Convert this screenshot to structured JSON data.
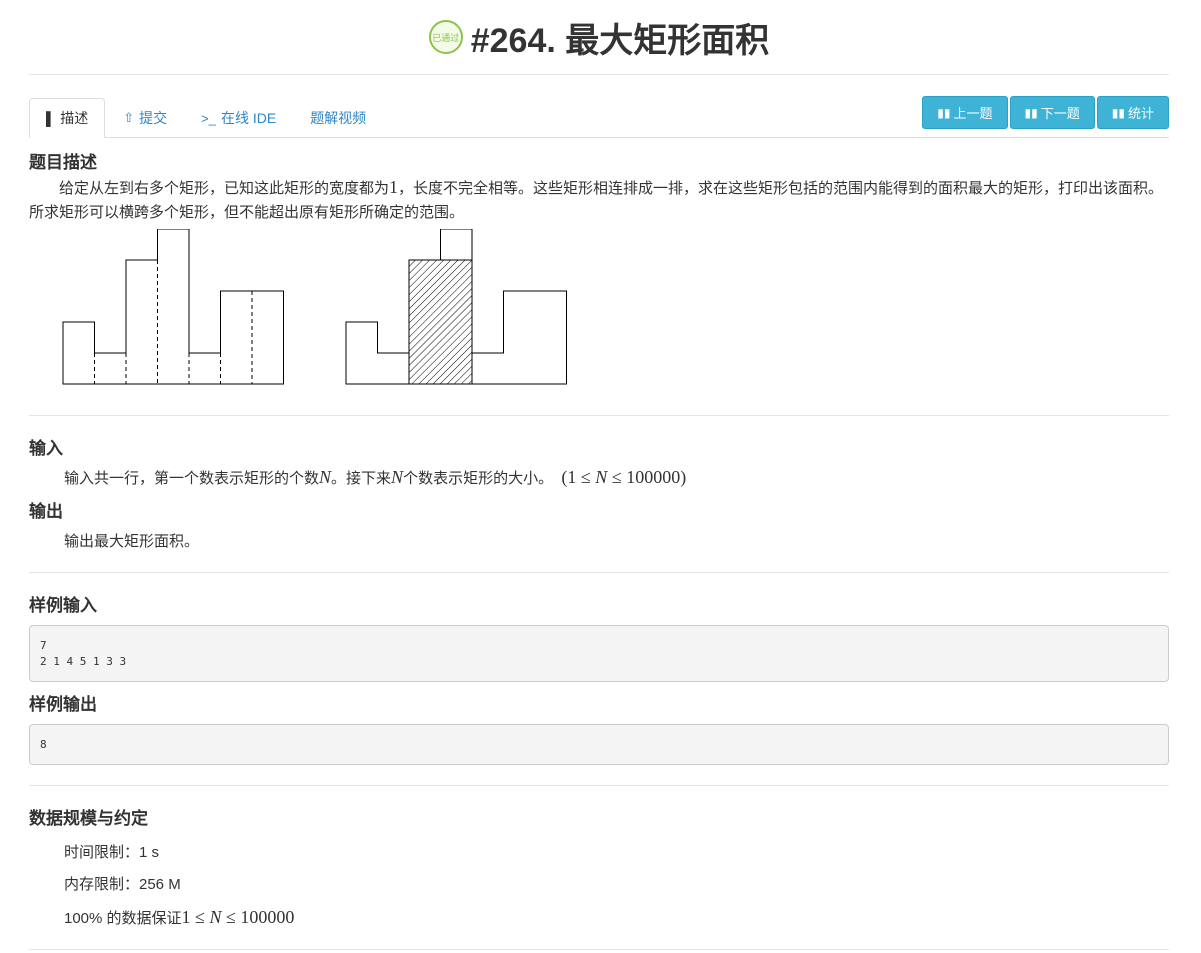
{
  "header": {
    "badge_text": "已通过",
    "title": "#264. 最大矩形面积"
  },
  "tabs": [
    {
      "icon": "book-icon",
      "glyph": "▌",
      "label": "描述"
    },
    {
      "icon": "upload-icon",
      "glyph": "⇧",
      "label": "提交"
    },
    {
      "icon": "terminal-icon",
      "glyph": ">_",
      "label": "在线 IDE"
    },
    {
      "icon": "",
      "glyph": "",
      "label": "题解视频"
    }
  ],
  "nav_buttons": [
    {
      "icon": "bar-chart-icon",
      "label": "上一题"
    },
    {
      "icon": "bar-chart-icon",
      "label": "下一题"
    },
    {
      "icon": "bar-chart-icon",
      "label": "统计"
    }
  ],
  "description": {
    "heading": "题目描述",
    "text_a": "给定从左到右多个矩形，已知这此矩形的宽度都为",
    "text_one": "1",
    "text_b": "，长度不完全相等。这些矩形相连排成一排，求在这些矩形包括的范围内能得到的面积最大的矩形，打印出该面积。所求矩形可以横跨多个矩形，但不能超出原有矩形所确定的范围。"
  },
  "figure": {
    "heights": [
      2,
      1,
      4,
      5,
      1,
      3,
      3
    ],
    "highlight": {
      "from": 2,
      "to": 3,
      "height": 4
    }
  },
  "input": {
    "heading": "输入",
    "text_a": "输入共一行，第一个数表示矩形的个数",
    "var_n": "N",
    "text_b": "。接下来",
    "var_n2": "N",
    "text_c": "个数表示矩形的大小。",
    "range_a": "(1 ≤ ",
    "range_n": "N",
    "range_b": " ≤ 100000)"
  },
  "output": {
    "heading": "输出",
    "text": "输出最大矩形面积。"
  },
  "sample_input": {
    "heading": "样例输入",
    "content": "7\n2 1 4 5 1 3 3"
  },
  "sample_output": {
    "heading": "样例输出",
    "content": "8"
  },
  "limits": {
    "heading": "数据规模与约定",
    "time": "时间限制：1 s",
    "memory": "内存限制：256 M",
    "data_a": "100% 的数据保证",
    "data_range_a": "1 ≤ ",
    "data_range_n": "N",
    "data_range_b": " ≤ 100000"
  }
}
